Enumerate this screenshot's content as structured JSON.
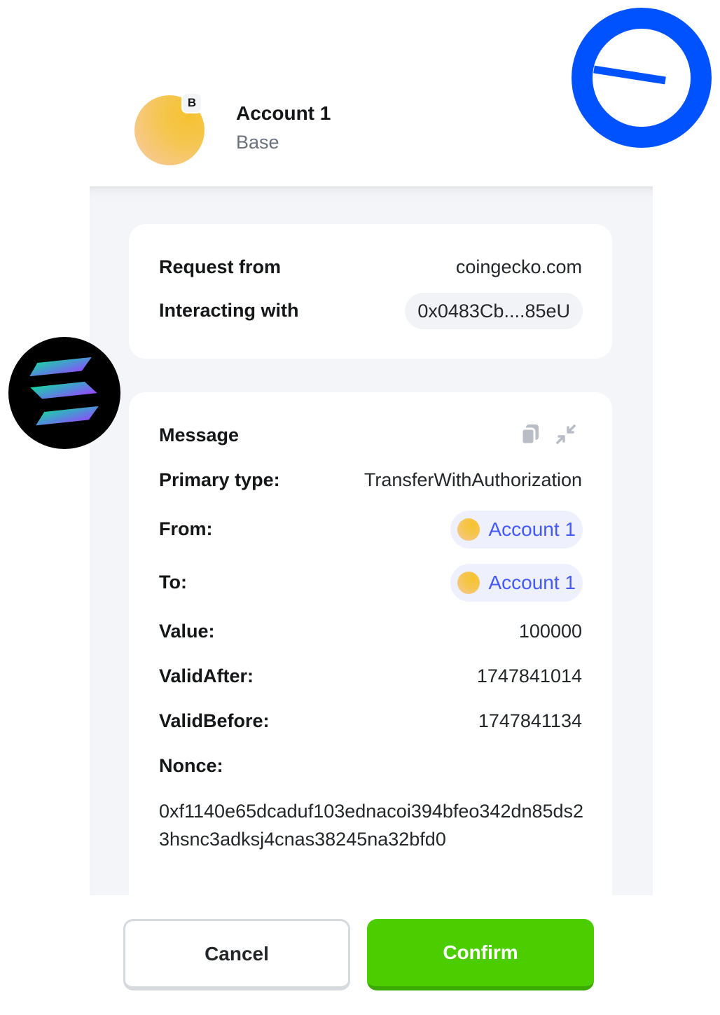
{
  "header": {
    "account_name": "Account 1",
    "network": "Base",
    "chain_badge": "B",
    "avatar_color": "#F6C230"
  },
  "request": {
    "request_from_label": "Request from",
    "request_from_value": "coingecko.com",
    "interacting_with_label": "Interacting with",
    "interacting_with_value": "0x0483Cb....85eU"
  },
  "message": {
    "title": "Message",
    "icons": [
      "copy-icon",
      "collapse-icon"
    ],
    "primary_type_label": "Primary type:",
    "primary_type_value": "TransferWithAuthorization",
    "from_label": "From:",
    "from_value": "Account 1",
    "to_label": "To:",
    "to_value": "Account 1",
    "value_label": "Value:",
    "value_value": "100000",
    "valid_after_label": "ValidAfter:",
    "valid_after_value": "1747841014",
    "valid_before_label": "ValidBefore:",
    "valid_before_value": "1747841134",
    "nonce_label": "Nonce:",
    "nonce_value": "0xf1140e65dcaduf103ednacoi394bfeo342dn85ds23hsnc3adksj4cnas38245na32bfd0"
  },
  "footer": {
    "cancel_label": "Cancel",
    "confirm_label": "Confirm"
  },
  "colors": {
    "accent_blue": "#4459FF",
    "confirm_green": "#4CCD00",
    "base_logo_blue": "#0052FF"
  },
  "decorations": [
    "base-logo",
    "solana-logo"
  ]
}
